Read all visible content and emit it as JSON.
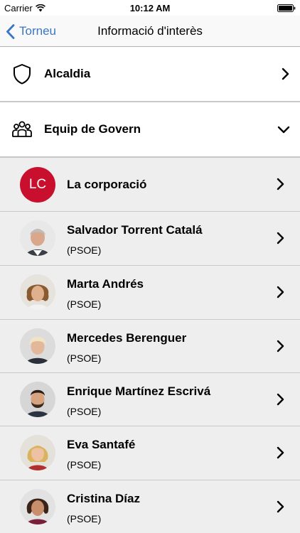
{
  "status_bar": {
    "carrier": "Carrier",
    "time": "10:12 AM"
  },
  "nav": {
    "back_label": "Torneu",
    "title": "Informació d'interès",
    "accent_color": "#3b76c4"
  },
  "sections": [
    {
      "label": "Alcaldia",
      "icon": "shield-icon",
      "state": "collapsed"
    },
    {
      "label": "Equip de Govern",
      "icon": "group-icon",
      "state": "expanded"
    }
  ],
  "members": [
    {
      "name": "La corporació",
      "party": "",
      "avatar": "LC",
      "avatar_color": "#c8102e"
    },
    {
      "name": "Salvador Torrent Catalá",
      "party": "(PSOE)",
      "avatar": "photo"
    },
    {
      "name": "Marta Andrés",
      "party": "(PSOE)",
      "avatar": "photo"
    },
    {
      "name": "Mercedes Berenguer",
      "party": "(PSOE)",
      "avatar": "photo"
    },
    {
      "name": "Enrique Martínez Escrivá",
      "party": "(PSOE)",
      "avatar": "photo"
    },
    {
      "name": "Eva Santafé",
      "party": "(PSOE)",
      "avatar": "photo"
    },
    {
      "name": "Cristina Díaz",
      "party": "(PSOE)",
      "avatar": "photo"
    }
  ]
}
